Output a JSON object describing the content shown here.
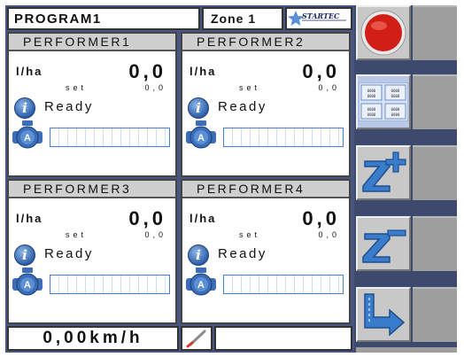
{
  "header": {
    "program": "PROGRAM1",
    "zone": "Zone 1",
    "logo_text": "STARTEC"
  },
  "performers": [
    {
      "title": "PERFORMER1",
      "rate_unit": "l/ha",
      "rate_value": "0,0",
      "set_label": "set",
      "set_value": "0,0",
      "status": "Ready",
      "mode_letter": "A",
      "progress_percent": 0
    },
    {
      "title": "PERFORMER2",
      "rate_unit": "l/ha",
      "rate_value": "0,0",
      "set_label": "set",
      "set_value": "0,0",
      "status": "Ready",
      "mode_letter": "A",
      "progress_percent": 0
    },
    {
      "title": "PERFORMER3",
      "rate_unit": "l/ha",
      "rate_value": "0,0",
      "set_label": "set",
      "set_value": "0,0",
      "status": "Ready",
      "mode_letter": "A",
      "progress_percent": 0
    },
    {
      "title": "PERFORMER4",
      "rate_unit": "l/ha",
      "rate_value": "0,0",
      "set_label": "set",
      "set_value": "0,0",
      "status": "Ready",
      "mode_letter": "A",
      "progress_percent": 0
    }
  ],
  "footer": {
    "speed": "0,00km/h",
    "tool_icon": "pen-icon"
  },
  "side_buttons": {
    "grid_cell_text": "0000"
  },
  "colors": {
    "screen_bg": "#4a5680",
    "panel_header": "#cfcfcf",
    "info_blue": "#2e5fa8",
    "stop_red": "#e0261c",
    "arrow_blue": "#3a7ccc",
    "button_gray": "#c8c8c8"
  }
}
